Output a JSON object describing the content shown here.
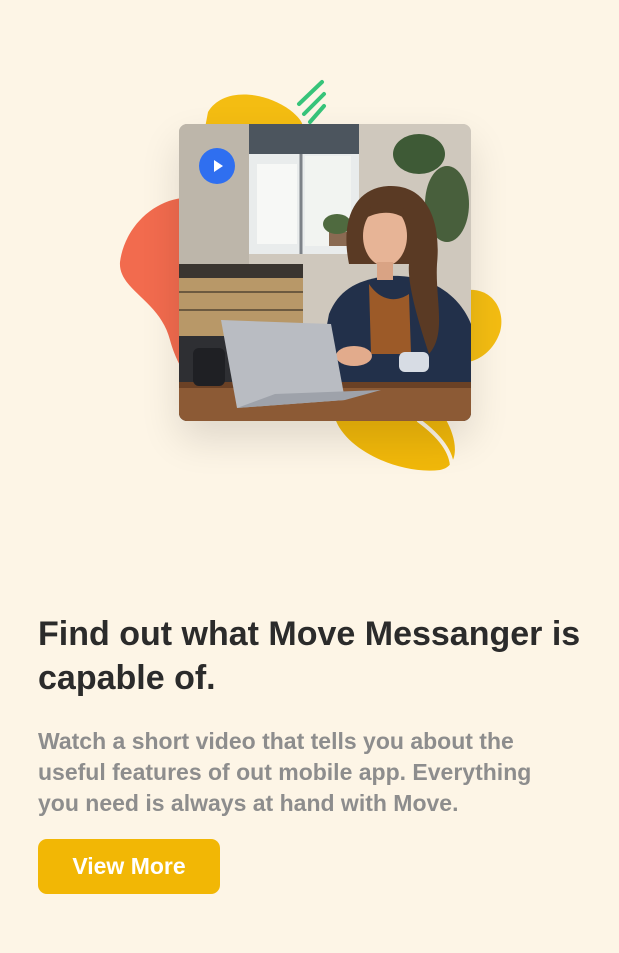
{
  "hero": {
    "video_card": {
      "play_icon": "play-icon"
    },
    "colors": {
      "coral_blob": "#f26b4e",
      "yellow_blob": "#f4bd12",
      "green_stripes": "#37c47a",
      "play_button": "#2f6ff0"
    }
  },
  "content": {
    "headline": "Find out what Move Messanger is capable of.",
    "description": "Watch a short video that tells you about the useful features of out mobile app. Everything you need is always at hand with Move.",
    "cta_label": "View More"
  },
  "colors": {
    "background": "#fdf5e6",
    "cta": "#f2b705",
    "headline": "#2b2b2b",
    "description": "#8d8d8d"
  }
}
